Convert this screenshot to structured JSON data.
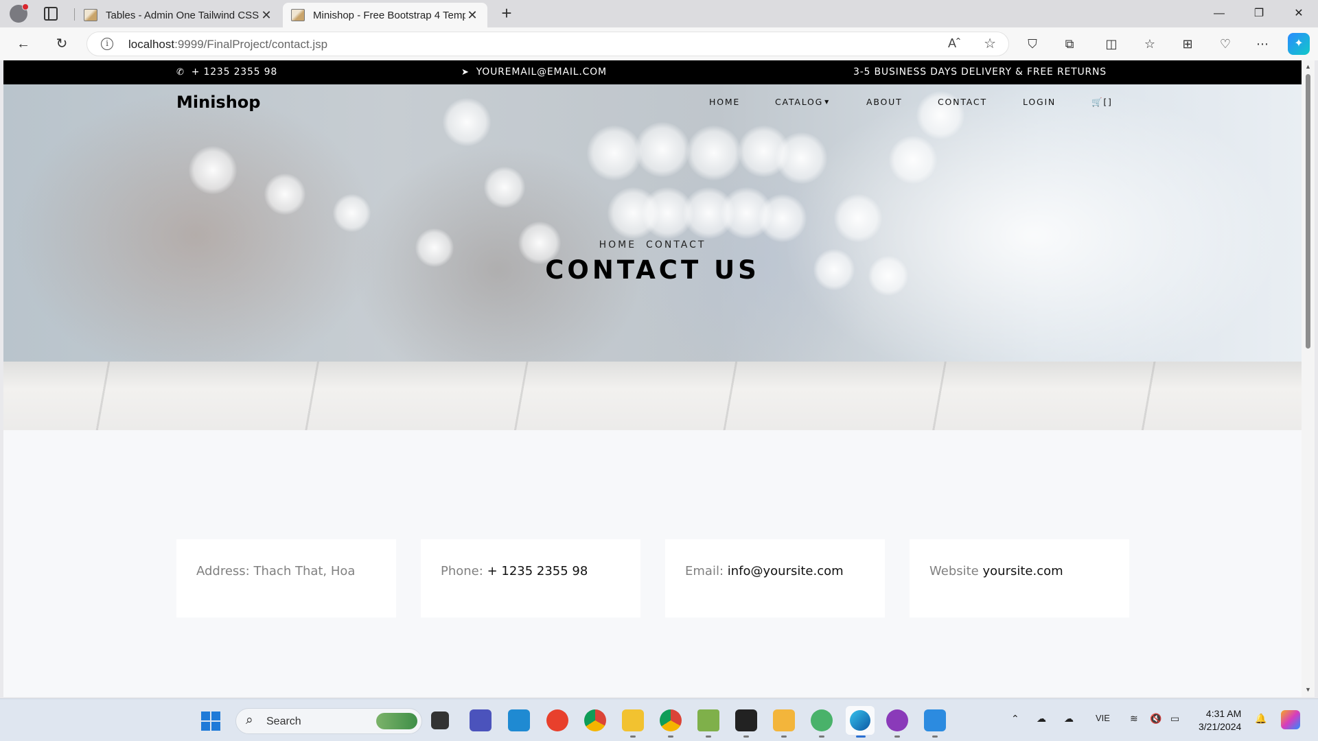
{
  "browser": {
    "tabs": [
      {
        "title": "Tables - Admin One Tailwind CSS"
      },
      {
        "title": "Minishop - Free Bootstrap 4 Template"
      }
    ],
    "url_host": "localhost",
    "url_rest": ":9999/FinalProject/contact.jsp",
    "read_aloud": "Aˆ"
  },
  "site": {
    "topbar": {
      "phone": "+ 1235 2355 98",
      "email": "YOUREMAIL@EMAIL.COM",
      "delivery": "3-5 BUSINESS DAYS DELIVERY & FREE RETURNS"
    },
    "brand": "Minishop",
    "nav": {
      "home": "HOME",
      "catalog": "CATALOG",
      "about": "ABOUT",
      "contact": "CONTACT",
      "login": "LOGIN",
      "cart": "[]"
    },
    "breadcrumb": [
      "HOME",
      "CONTACT"
    ],
    "page_title": "CONTACT US",
    "info_cards": [
      {
        "label": "Address:",
        "value": "Thach That, Hoa"
      },
      {
        "label": "Phone:",
        "value": "+ 1235 2355 98"
      },
      {
        "label": "Email:",
        "value": "info@yoursite.com"
      },
      {
        "label": "Website",
        "value": "yoursite.com"
      }
    ]
  },
  "taskbar": {
    "search_label": "Search",
    "language": "VIE",
    "time": "4:31 AM",
    "date": "3/21/2024"
  }
}
